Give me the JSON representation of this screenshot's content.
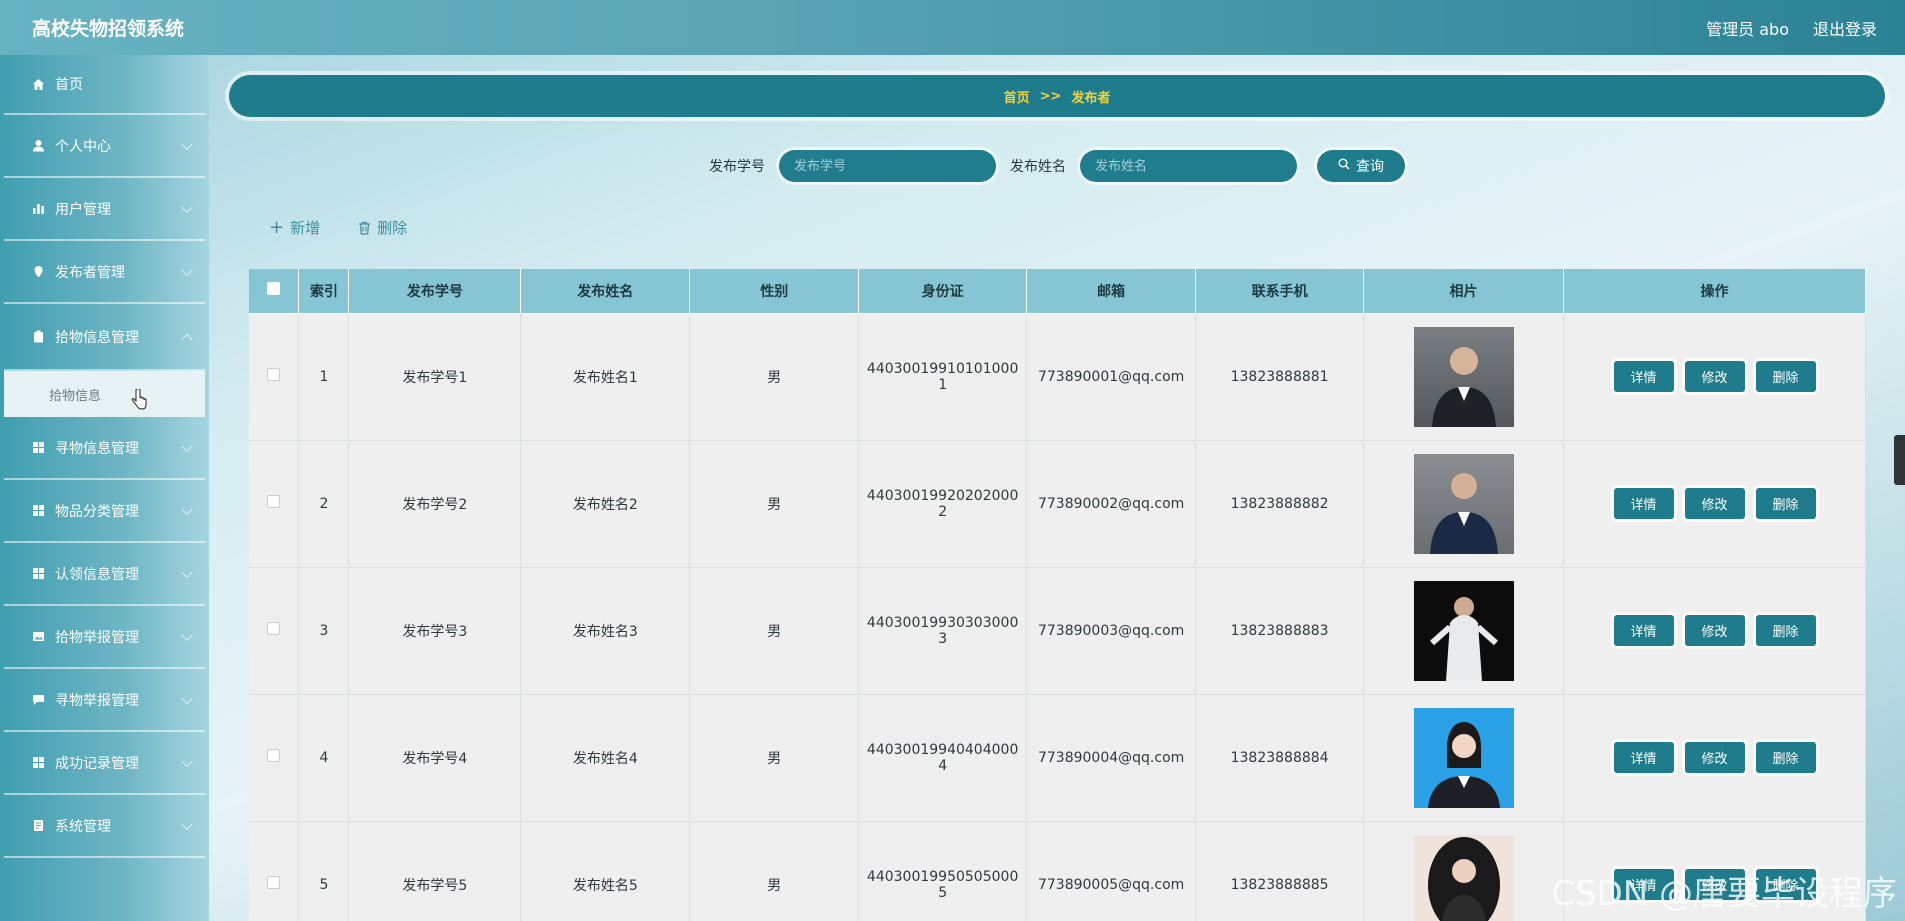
{
  "app": {
    "title": "高校失物招领系统"
  },
  "header": {
    "user_label": "管理员 abo",
    "logout_label": "退出登录"
  },
  "sidebar": {
    "items": [
      {
        "label": "首页",
        "icon": "home-icon"
      },
      {
        "label": "个人中心",
        "icon": "user-icon"
      },
      {
        "label": "用户管理",
        "icon": "bar-chart-icon"
      },
      {
        "label": "发布者管理",
        "icon": "location-pin-icon"
      },
      {
        "label": "拾物信息管理",
        "icon": "clipboard-icon",
        "sub": [
          {
            "label": "拾物信息"
          }
        ]
      },
      {
        "label": "寻物信息管理",
        "icon": "grid-icon"
      },
      {
        "label": "物品分类管理",
        "icon": "grid-icon"
      },
      {
        "label": "认领信息管理",
        "icon": "grid-icon"
      },
      {
        "label": "拾物举报管理",
        "icon": "image-icon"
      },
      {
        "label": "寻物举报管理",
        "icon": "message-icon"
      },
      {
        "label": "成功记录管理",
        "icon": "grid-icon"
      },
      {
        "label": "系统管理",
        "icon": "document-icon"
      }
    ]
  },
  "breadcrumb": {
    "home": "首页",
    "separator": ">>",
    "current": "发布者"
  },
  "search": {
    "field1_label": "发布学号",
    "field1_placeholder": "发布学号",
    "field2_label": "发布姓名",
    "field2_placeholder": "发布姓名",
    "query_label": "查询"
  },
  "actions": {
    "add_label": "新增",
    "delete_label": "删除"
  },
  "table": {
    "columns": [
      "索引",
      "发布学号",
      "发布姓名",
      "性别",
      "身份证",
      "邮箱",
      "联系手机",
      "相片",
      "操作"
    ],
    "rows": [
      {
        "index": "1",
        "student_id": "发布学号1",
        "name": "发布姓名1",
        "gender": "男",
        "id_card_l1": "44030019910101000",
        "id_card_l2": "1",
        "email": "773890001@qq.com",
        "phone": "13823888881"
      },
      {
        "index": "2",
        "student_id": "发布学号2",
        "name": "发布姓名2",
        "gender": "男",
        "id_card_l1": "44030019920202000",
        "id_card_l2": "2",
        "email": "773890002@qq.com",
        "phone": "13823888882"
      },
      {
        "index": "3",
        "student_id": "发布学号3",
        "name": "发布姓名3",
        "gender": "男",
        "id_card_l1": "44030019930303000",
        "id_card_l2": "3",
        "email": "773890003@qq.com",
        "phone": "13823888883"
      },
      {
        "index": "4",
        "student_id": "发布学号4",
        "name": "发布姓名4",
        "gender": "男",
        "id_card_l1": "44030019940404000",
        "id_card_l2": "4",
        "email": "773890004@qq.com",
        "phone": "13823888884"
      },
      {
        "index": "5",
        "student_id": "发布学号5",
        "name": "发布姓名5",
        "gender": "男",
        "id_card_l1": "44030019950505000",
        "id_card_l2": "5",
        "email": "773890005@qq.com",
        "phone": "13823888885"
      }
    ],
    "op_labels": {
      "detail": "详情",
      "edit": "修改",
      "delete": "删除"
    }
  },
  "watermark": "CSDN @唐要毕设程序",
  "colors": {
    "accent": "#1e7c8d",
    "header_bg": "#5aa4b4",
    "breadcrumb_text": "#f6d23a",
    "table_header": "#86c6d4"
  }
}
